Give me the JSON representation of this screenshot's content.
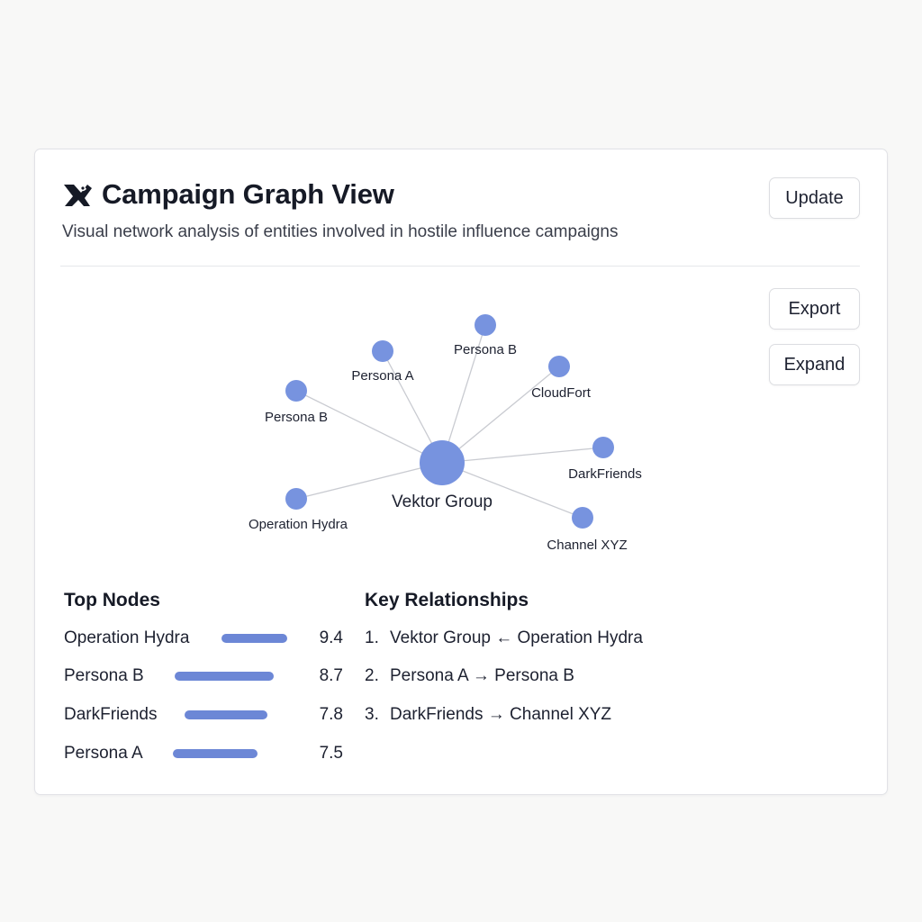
{
  "header": {
    "title": "Campaign Graph View",
    "subtitle": "Visual network analysis of entities involved in hostile influence campaigns",
    "logo_icon": "bird-logo-icon",
    "update_label": "Update"
  },
  "toolbar": {
    "export_label": "Export",
    "expand_label": "Expand"
  },
  "graph": {
    "center": "Vektor Group",
    "nodes": [
      {
        "label": "Persona A"
      },
      {
        "label": "Persona B"
      },
      {
        "label": "CloudFort"
      },
      {
        "label": "Persona B"
      },
      {
        "label": "DarkFriends"
      },
      {
        "label": "Operation Hydra"
      },
      {
        "label": "Channel XYZ"
      }
    ]
  },
  "top_nodes": {
    "title": "Top Nodes",
    "items": [
      {
        "name": "Operation Hydra",
        "value": "9.4"
      },
      {
        "name": "Persona B",
        "value": "8.7"
      },
      {
        "name": "DarkFriends",
        "value": "7.8"
      },
      {
        "name": "Persona A",
        "value": "7.5"
      }
    ]
  },
  "key_relationships": {
    "title": "Key Relationships",
    "items": [
      {
        "num": "1.",
        "text": "Vektor Group ← Operation Hydra"
      },
      {
        "num": "2.",
        "text": "Persona A → Persona B"
      },
      {
        "num": "3.",
        "text": "DarkFriends → Channel XYZ"
      }
    ]
  },
  "colors": {
    "node": "#7793df",
    "bar": "#6c87d6",
    "edge": "#c9cbd1"
  }
}
